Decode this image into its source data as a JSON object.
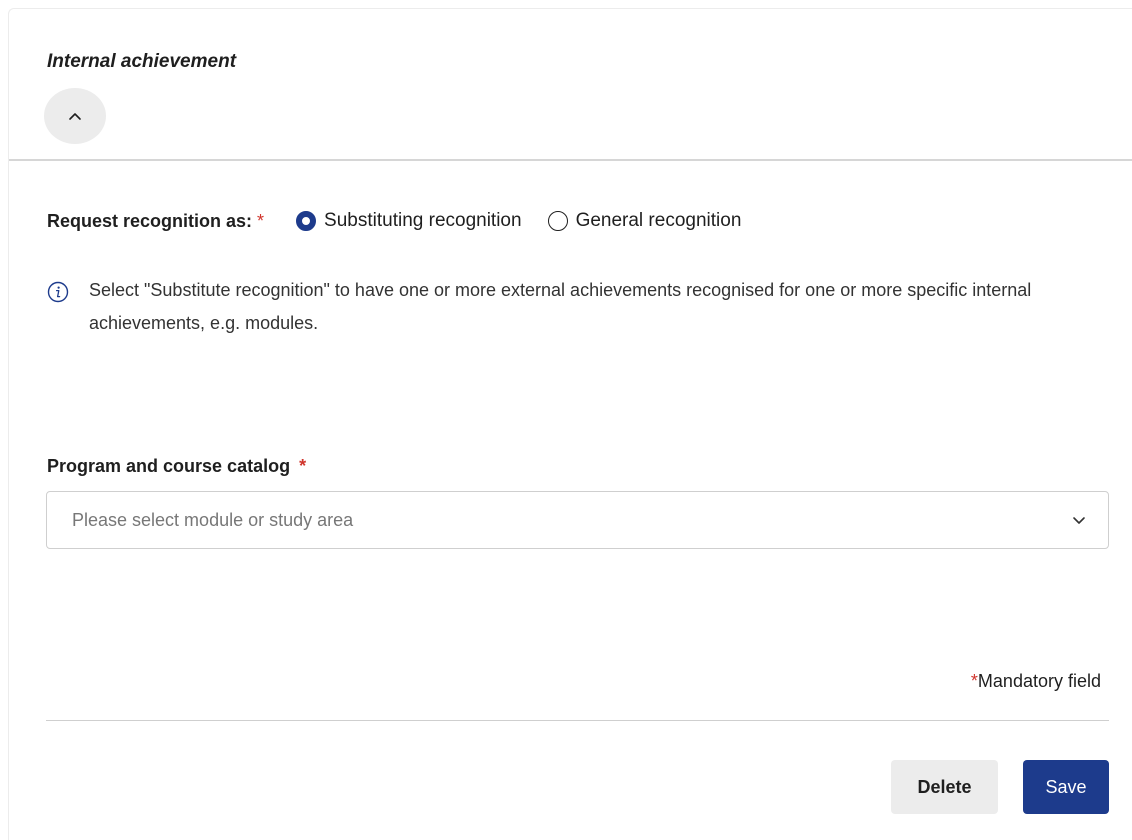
{
  "section": {
    "title": "Internal achievement",
    "collapse_icon": "chevron-up-icon"
  },
  "recognition": {
    "label": "Request recognition as:",
    "required_marker": "*",
    "options": [
      {
        "label": "Substituting recognition",
        "selected": true
      },
      {
        "label": "General recognition",
        "selected": false
      }
    ]
  },
  "info": {
    "icon": "info-icon",
    "text": "Select \"Substitute recognition\" to have one or more external achievements recognised for one or more specific internal achievements, e.g. modules."
  },
  "catalog": {
    "label": "Program and course catalog",
    "required_marker": "*",
    "placeholder": "Please select module or study area",
    "chevron_icon": "chevron-down-icon"
  },
  "mandatory_note": {
    "star": "*",
    "text": "Mandatory field"
  },
  "actions": {
    "delete_label": "Delete",
    "save_label": "Save"
  },
  "colors": {
    "accent": "#1d3b8c",
    "required": "#d0342c",
    "neutral_button": "#ececec"
  }
}
